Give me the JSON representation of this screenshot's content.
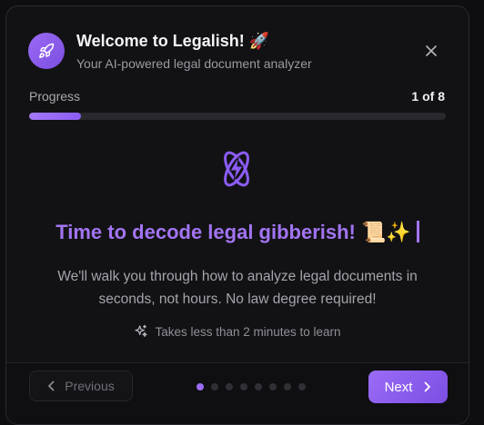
{
  "header": {
    "title": "Welcome to Legalish! 🚀",
    "subtitle": "Your AI-powered legal document analyzer",
    "logo_icon": "rocket-icon",
    "close_icon": "close-icon"
  },
  "progress": {
    "label": "Progress",
    "count": "1 of 8",
    "value_fraction": 0.125
  },
  "step": {
    "icon": "atom-bolt-icon",
    "headline": "Time to decode legal gibberish! 📜✨",
    "description": "We'll walk you through how to analyze legal documents in seconds, not hours. No law degree required!",
    "hint": "Takes less than 2 minutes to learn",
    "hint_icon": "sparkles-icon"
  },
  "footer": {
    "previous_label": "Previous",
    "next_label": "Next",
    "total_steps": 8,
    "current_step": 1
  },
  "colors": {
    "accent": "#9b6cf6",
    "headline": "#a274f2",
    "background": "#121214"
  }
}
